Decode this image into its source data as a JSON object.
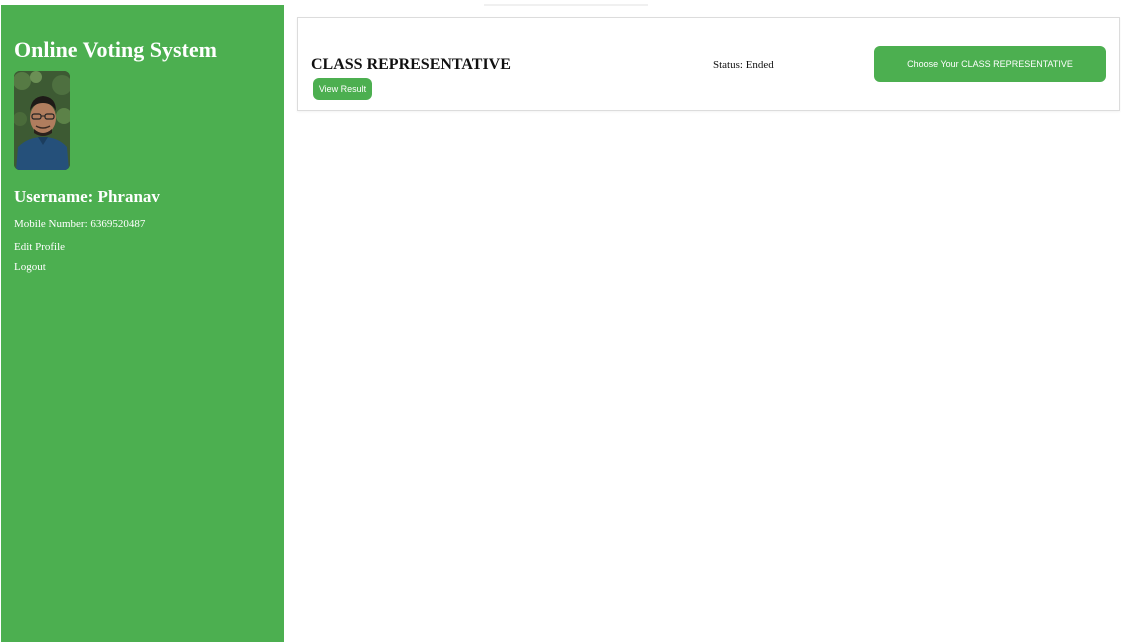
{
  "sidebar": {
    "app_title": "Online Voting System",
    "avatar_icon": "user-photo",
    "username": "Username: Phranav",
    "mobile": "Mobile Number: 6369520487",
    "edit_profile_label": "Edit Profile",
    "logout_label": "Logout",
    "background_color": "#4caf50"
  },
  "elections": [
    {
      "title": "CLASS REPRESENTATIVE",
      "status": "Status: Ended",
      "view_result_label": "View Result",
      "choose_label": "Choose Your CLASS REPRESENTATIVE"
    }
  ],
  "colors": {
    "accent": "#4caf50",
    "text": "#111111",
    "card_border": "#dcdcdc"
  }
}
